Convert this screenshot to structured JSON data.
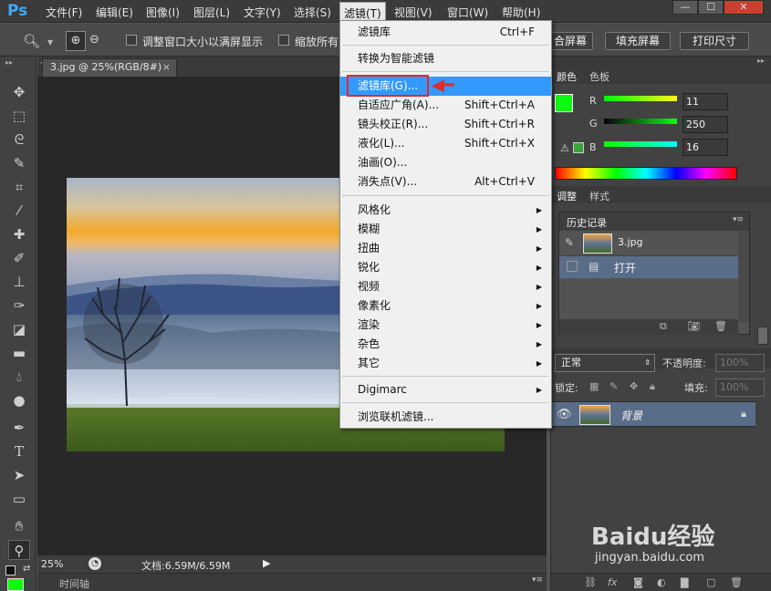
{
  "app": {
    "logo": "Ps"
  },
  "menubar": {
    "items": [
      "文件(F)",
      "编辑(E)",
      "图像(I)",
      "图层(L)",
      "文字(Y)",
      "选择(S)",
      "滤镜(T)",
      "视图(V)",
      "窗口(W)",
      "帮助(H)"
    ],
    "active": "滤镜(T)"
  },
  "window_buttons": [
    "—",
    "☐",
    "✕"
  ],
  "options_bar": {
    "resize_windows_label": "调整窗口大小以满屏显示",
    "zoom_all_label": "缩放所有",
    "fill_screen_label": "合屏幕",
    "fill_screen2_label": "填充屏幕",
    "print_size_label": "打印尺寸"
  },
  "document": {
    "tab_title": "3.jpg @ 25%(RGB/8#)",
    "zoom": "25%",
    "doc_size": "文档:6.59M/6.59M",
    "timeline_label": "时间轴"
  },
  "filter_menu": {
    "items": [
      {
        "label": "滤镜库",
        "shortcut": "Ctrl+F"
      },
      {
        "label": "转换为智能滤镜",
        "shortcut": ""
      },
      {
        "label": "滤镜库(G)...",
        "shortcut": ""
      },
      {
        "label": "自适应广角(A)...",
        "shortcut": "Shift+Ctrl+A"
      },
      {
        "label": "镜头校正(R)...",
        "shortcut": "Shift+Ctrl+R"
      },
      {
        "label": "液化(L)...",
        "shortcut": "Shift+Ctrl+X"
      },
      {
        "label": "油画(O)...",
        "shortcut": ""
      },
      {
        "label": "消失点(V)...",
        "shortcut": "Alt+Ctrl+V"
      },
      {
        "label": "风格化",
        "shortcut": ""
      },
      {
        "label": "模糊",
        "shortcut": ""
      },
      {
        "label": "扭曲",
        "shortcut": ""
      },
      {
        "label": "锐化",
        "shortcut": ""
      },
      {
        "label": "视频",
        "shortcut": ""
      },
      {
        "label": "像素化",
        "shortcut": ""
      },
      {
        "label": "渲染",
        "shortcut": ""
      },
      {
        "label": "杂色",
        "shortcut": ""
      },
      {
        "label": "其它",
        "shortcut": ""
      },
      {
        "label": "Digimarc",
        "shortcut": ""
      },
      {
        "label": "浏览联机滤镜...",
        "shortcut": ""
      }
    ],
    "highlighted": "滤镜库(G)..."
  },
  "color_panel": {
    "tabs": [
      "颜色",
      "色板"
    ],
    "r_label": "R",
    "g_label": "G",
    "b_label": "B",
    "r": "11",
    "g": "250",
    "b": "16",
    "foreground_color": "#0bfa10"
  },
  "adjust_panel": {
    "tabs": [
      "调整",
      "样式"
    ]
  },
  "history_panel": {
    "title": "历史记录",
    "snapshot": "3.jpg",
    "steps": [
      "打开"
    ]
  },
  "layers_panel": {
    "blend_mode": "正常",
    "opacity_label": "不透明度:",
    "opacity": "100%",
    "lock_label": "锁定:",
    "fill_label": "填充:",
    "fill": "100%",
    "layers": [
      {
        "name": "背景"
      }
    ]
  },
  "watermark": {
    "brand": "Baidu经验",
    "url": "jingyan.baidu.com"
  }
}
